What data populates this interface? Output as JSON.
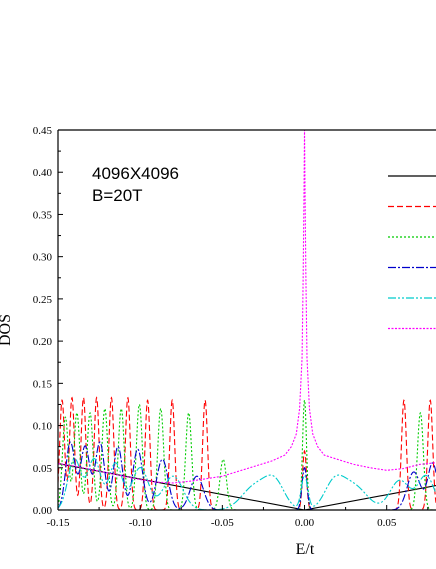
{
  "chart_data": {
    "type": "line",
    "xlabel": "E/t",
    "ylabel": "DOS",
    "xlim": [
      -0.15,
      0.08
    ],
    "ylim": [
      0.0,
      0.45
    ],
    "x_ticks": [
      -0.15,
      -0.1,
      -0.05,
      0.0,
      0.05
    ],
    "x_tick_labels": [
      "-0.15",
      "-0.10",
      "-0.05",
      "0.00",
      "0.05"
    ],
    "y_ticks": [
      0.0,
      0.05,
      0.1,
      0.15,
      0.2,
      0.25,
      0.3,
      0.35,
      0.4,
      0.45
    ],
    "y_tick_labels": [
      "0.00",
      "0.05",
      "0.10",
      "0.15",
      "0.20",
      "0.25",
      "0.30",
      "0.35",
      "0.40",
      "0.45"
    ],
    "annotations": [
      "4096X4096",
      "B=20T"
    ],
    "grid": false,
    "legend_position": "right, partially cropped",
    "series": [
      {
        "color": "#000000",
        "dash": "solid",
        "kind": "linear-v",
        "points": [
          [
            -0.15,
            0.055
          ],
          [
            0.0,
            0.0
          ],
          [
            0.08,
            0.029
          ]
        ]
      },
      {
        "color": "#ff0000",
        "dash": "6,3",
        "kind": "peaks",
        "baseline": 0.0,
        "peaks": [
          {
            "x": -0.1475,
            "h": 0.13,
            "w": 0.0015
          },
          {
            "x": -0.1415,
            "h": 0.133,
            "w": 0.0015
          },
          {
            "x": -0.1345,
            "h": 0.133,
            "w": 0.0015
          },
          {
            "x": -0.1265,
            "h": 0.133,
            "w": 0.0015
          },
          {
            "x": -0.1175,
            "h": 0.133,
            "w": 0.0015
          },
          {
            "x": -0.1075,
            "h": 0.133,
            "w": 0.0015
          },
          {
            "x": -0.0955,
            "h": 0.13,
            "w": 0.0015
          },
          {
            "x": -0.0805,
            "h": 0.13,
            "w": 0.0015
          },
          {
            "x": -0.0605,
            "h": 0.13,
            "w": 0.0015
          },
          {
            "x": 0.0,
            "h": 0.07,
            "w": 0.0012
          },
          {
            "x": 0.0605,
            "h": 0.13,
            "w": 0.0015
          },
          {
            "x": 0.0765,
            "h": 0.13,
            "w": 0.0015
          }
        ]
      },
      {
        "color": "#00cc00",
        "dash": "2,2",
        "kind": "peaks",
        "baseline": 0.0,
        "peaks": [
          {
            "x": -0.1455,
            "h": 0.11,
            "w": 0.0018
          },
          {
            "x": -0.1385,
            "h": 0.115,
            "w": 0.0018
          },
          {
            "x": -0.1305,
            "h": 0.115,
            "w": 0.0018
          },
          {
            "x": -0.1215,
            "h": 0.12,
            "w": 0.0018
          },
          {
            "x": -0.1115,
            "h": 0.12,
            "w": 0.0018
          },
          {
            "x": -0.1005,
            "h": 0.125,
            "w": 0.0018
          },
          {
            "x": -0.0875,
            "h": 0.12,
            "w": 0.0018
          },
          {
            "x": -0.0705,
            "h": 0.115,
            "w": 0.0018
          },
          {
            "x": -0.0495,
            "h": 0.06,
            "w": 0.002
          },
          {
            "x": 0.0,
            "h": 0.13,
            "w": 0.0012
          },
          {
            "x": 0.0705,
            "h": 0.115,
            "w": 0.0018
          }
        ]
      },
      {
        "color": "#0000cc",
        "dash": "8,2,2,2",
        "kind": "peaks",
        "baseline": 0.0,
        "peaks": [
          {
            "x": -0.1425,
            "h": 0.08,
            "w": 0.0028
          },
          {
            "x": -0.1335,
            "h": 0.075,
            "w": 0.0028
          },
          {
            "x": -0.1245,
            "h": 0.08,
            "w": 0.0028
          },
          {
            "x": -0.1135,
            "h": 0.075,
            "w": 0.0028
          },
          {
            "x": -0.1015,
            "h": 0.072,
            "w": 0.003
          },
          {
            "x": -0.0865,
            "h": 0.06,
            "w": 0.0035
          },
          {
            "x": -0.0655,
            "h": 0.04,
            "w": 0.004
          },
          {
            "x": 0.0,
            "h": 0.05,
            "w": 0.0015
          },
          {
            "x": 0.0665,
            "h": 0.045,
            "w": 0.004
          },
          {
            "x": 0.078,
            "h": 0.055,
            "w": 0.003
          }
        ]
      },
      {
        "color": "#00cccc",
        "dash": "8,2,2,2,2,2",
        "kind": "peaks",
        "baseline": 0.0,
        "peaks": [
          {
            "x": -0.14,
            "h": 0.06,
            "w": 0.004
          },
          {
            "x": -0.128,
            "h": 0.06,
            "w": 0.004
          },
          {
            "x": -0.115,
            "h": 0.055,
            "w": 0.004
          },
          {
            "x": -0.1,
            "h": 0.05,
            "w": 0.005
          },
          {
            "x": -0.08,
            "h": 0.04,
            "w": 0.006
          },
          {
            "x": -0.03,
            "h": 0.028,
            "w": 0.008
          },
          {
            "x": -0.018,
            "h": 0.03,
            "w": 0.006
          },
          {
            "x": 0.0,
            "h": 0.04,
            "w": 0.002
          },
          {
            "x": 0.018,
            "h": 0.03,
            "w": 0.006
          },
          {
            "x": 0.03,
            "h": 0.028,
            "w": 0.008
          },
          {
            "x": 0.058,
            "h": 0.035,
            "w": 0.006
          },
          {
            "x": 0.074,
            "h": 0.04,
            "w": 0.005
          }
        ]
      },
      {
        "color": "#ff00ff",
        "dash": "2,1.5",
        "kind": "envelope",
        "points": [
          [
            -0.15,
            0.055
          ],
          [
            -0.14,
            0.052
          ],
          [
            -0.13,
            0.048
          ],
          [
            -0.12,
            0.044
          ],
          [
            -0.11,
            0.04
          ],
          [
            -0.1,
            0.036
          ],
          [
            -0.09,
            0.033
          ],
          [
            -0.08,
            0.032
          ],
          [
            -0.07,
            0.034
          ],
          [
            -0.06,
            0.037
          ],
          [
            -0.05,
            0.04
          ],
          [
            -0.04,
            0.046
          ],
          [
            -0.03,
            0.052
          ],
          [
            -0.02,
            0.058
          ],
          [
            -0.012,
            0.065
          ],
          [
            -0.008,
            0.075
          ],
          [
            -0.005,
            0.09
          ],
          [
            -0.003,
            0.12
          ],
          [
            -0.0015,
            0.18
          ],
          [
            -0.0008,
            0.28
          ],
          [
            -0.0003,
            0.38
          ],
          [
            0.0,
            0.45
          ],
          [
            0.0003,
            0.38
          ],
          [
            0.0008,
            0.28
          ],
          [
            0.0015,
            0.18
          ],
          [
            0.003,
            0.12
          ],
          [
            0.005,
            0.09
          ],
          [
            0.008,
            0.075
          ],
          [
            0.012,
            0.065
          ],
          [
            0.02,
            0.06
          ],
          [
            0.03,
            0.054
          ],
          [
            0.04,
            0.05
          ],
          [
            0.05,
            0.047
          ],
          [
            0.06,
            0.049
          ],
          [
            0.07,
            0.054
          ],
          [
            0.08,
            0.056
          ]
        ]
      }
    ]
  }
}
